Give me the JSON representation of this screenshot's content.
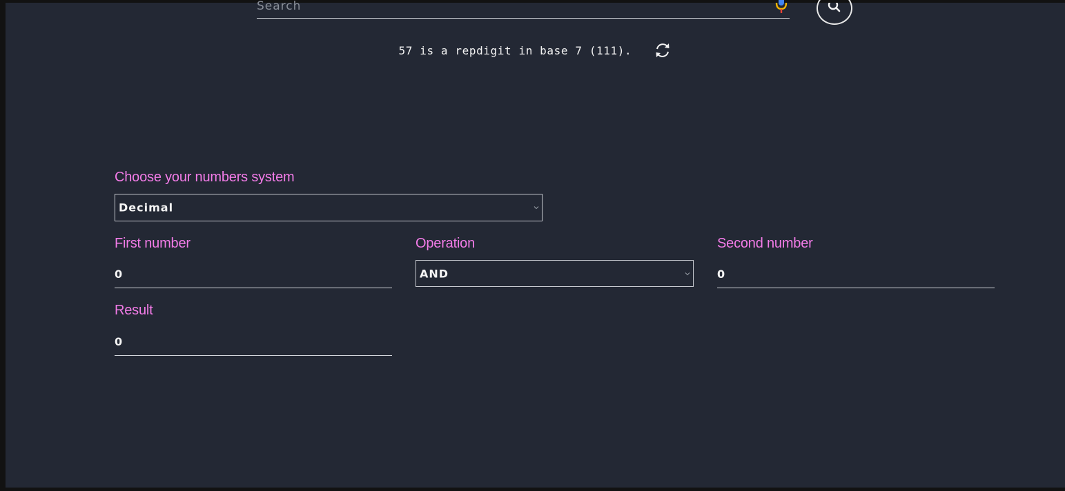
{
  "search": {
    "placeholder": "Search"
  },
  "fact": {
    "text": "57 is a repdigit in base 7 (111)."
  },
  "form": {
    "number_system_label": "Choose your numbers system",
    "number_system_value": "Decimal",
    "first_number_label": "First number",
    "first_number_value": "0",
    "operation_label": "Operation",
    "operation_value": "AND",
    "second_number_label": "Second number",
    "second_number_value": "0",
    "result_label": "Result",
    "result_value": "0"
  },
  "colors": {
    "background": "#232834",
    "label_accent": "#f37ce8",
    "text": "#f5f5f5"
  },
  "icons": [
    "microphone-icon",
    "search-icon",
    "refresh-icon",
    "chevron-down-icon"
  ]
}
